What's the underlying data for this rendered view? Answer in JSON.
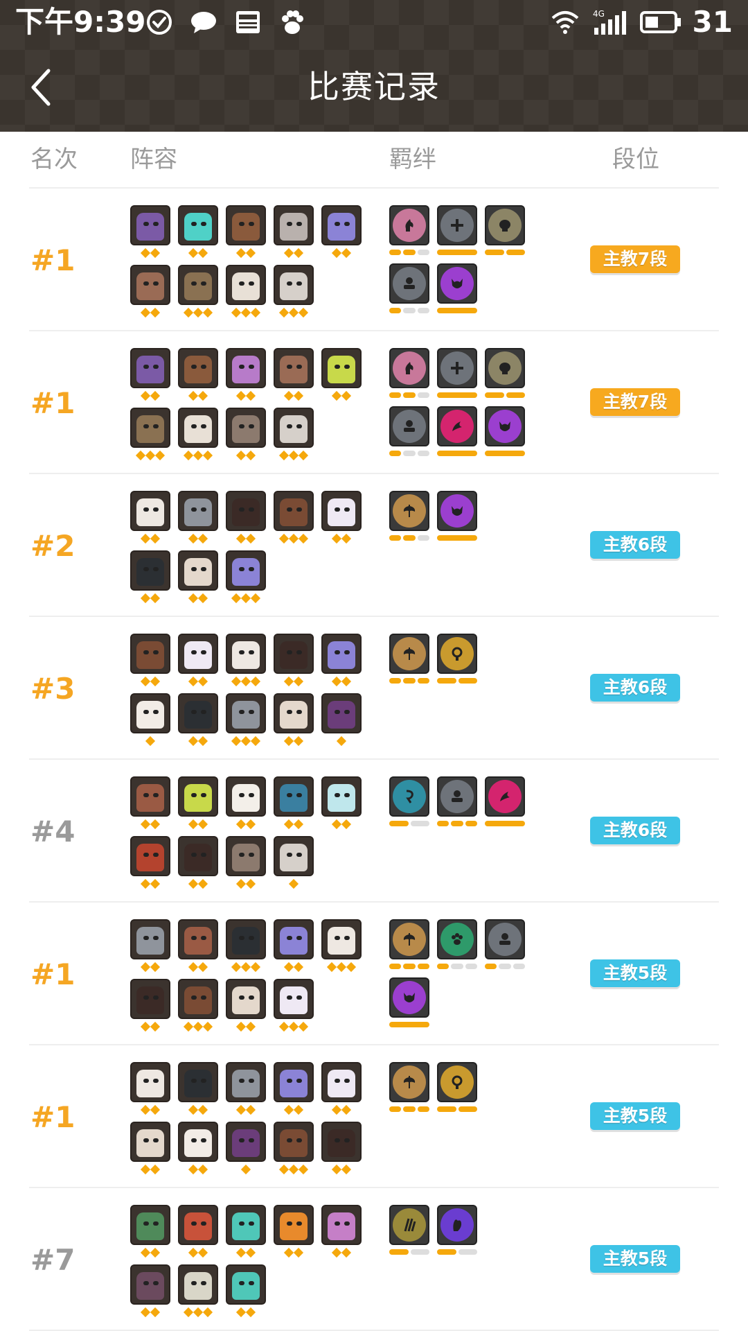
{
  "status_bar": {
    "time": "下午9:39",
    "icons": [
      "check-circle-icon",
      "chat-bubble-icon",
      "news-icon",
      "baidu-paw-icon"
    ],
    "network": "4G",
    "battery": "31"
  },
  "header": {
    "title": "比赛记录",
    "back_icon": "chevron-left-icon"
  },
  "columns": {
    "rank": "名次",
    "lineup": "阵容",
    "bonds": "羁绊",
    "tier": "段位"
  },
  "colors": {
    "rank_gold": "#f5a623",
    "rank_grey": "#9a9a9a",
    "tier_orange": "#f7a91f",
    "tier_cyan": "#3ec3e6",
    "star": "#f5a80c",
    "progress_on": "#f5a80c",
    "progress_off": "#dddddd"
  },
  "matches": [
    {
      "rank": "#1",
      "rank_color": "gold",
      "tier": "主教7段",
      "tier_color": "orange",
      "heroes": [
        {
          "face": "#7b5aa6",
          "stars": 2
        },
        {
          "face": "#4fd1c7",
          "stars": 2
        },
        {
          "face": "#8a5a3c",
          "stars": 2
        },
        {
          "face": "#b9b1ad",
          "stars": 2
        },
        {
          "face": "#8b83d6",
          "stars": 2
        },
        {
          "face": "#9a6b55",
          "stars": 2
        },
        {
          "face": "#8a7152",
          "stars": 3
        },
        {
          "face": "#e8e0d6",
          "stars": 3
        },
        {
          "face": "#d6d0ca",
          "stars": 3
        }
      ],
      "bonds": [
        {
          "color": "#c8789a",
          "glyph": "knight",
          "level": [
            2,
            3
          ]
        },
        {
          "color": "#6e737a",
          "glyph": "cross",
          "level": [
            1,
            1
          ]
        },
        {
          "color": "#8c8566",
          "glyph": "skull",
          "level": [
            2,
            2
          ]
        },
        {
          "color": "#6e737a",
          "glyph": "seat",
          "level": [
            1,
            3
          ]
        },
        {
          "color": "#9b3fcf",
          "glyph": "demon",
          "level": [
            1,
            1
          ]
        }
      ]
    },
    {
      "rank": "#1",
      "rank_color": "gold",
      "tier": "主教7段",
      "tier_color": "orange",
      "heroes": [
        {
          "face": "#7b5aa6",
          "stars": 2
        },
        {
          "face": "#8a5a3c",
          "stars": 2
        },
        {
          "face": "#b77bc9",
          "stars": 2
        },
        {
          "face": "#9a6b55",
          "stars": 2
        },
        {
          "face": "#c8d94a",
          "stars": 2
        },
        {
          "face": "#8a7152",
          "stars": 3
        },
        {
          "face": "#e8e0d6",
          "stars": 3
        },
        {
          "face": "#8c7a6e",
          "stars": 2
        },
        {
          "face": "#d6d0ca",
          "stars": 3
        }
      ],
      "bonds": [
        {
          "color": "#c8789a",
          "glyph": "knight",
          "level": [
            2,
            3
          ]
        },
        {
          "color": "#6e737a",
          "glyph": "cross",
          "level": [
            1,
            1
          ]
        },
        {
          "color": "#8c8566",
          "glyph": "skull",
          "level": [
            2,
            2
          ]
        },
        {
          "color": "#6e737a",
          "glyph": "seat",
          "level": [
            1,
            3
          ]
        },
        {
          "color": "#d4246e",
          "glyph": "dragon",
          "level": [
            1,
            1
          ]
        },
        {
          "color": "#9b3fcf",
          "glyph": "demon",
          "level": [
            1,
            1
          ]
        }
      ]
    },
    {
      "rank": "#2",
      "rank_color": "gold",
      "tier": "主教6段",
      "tier_color": "cyan",
      "heroes": [
        {
          "face": "#eee8e2",
          "stars": 2
        },
        {
          "face": "#8f949c",
          "stars": 2
        },
        {
          "face": "#3b2a26",
          "stars": 2
        },
        {
          "face": "#7a4b34",
          "stars": 3
        },
        {
          "face": "#efe9f4",
          "stars": 2
        },
        {
          "face": "#2b2f33",
          "stars": 2
        },
        {
          "face": "#e4d8cc",
          "stars": 2
        },
        {
          "face": "#8b83d6",
          "stars": 3
        }
      ],
      "bonds": [
        {
          "color": "#b88a4a",
          "glyph": "axe",
          "level": [
            2,
            3
          ]
        },
        {
          "color": "#9b3fcf",
          "glyph": "demon",
          "level": [
            1,
            1
          ]
        }
      ]
    },
    {
      "rank": "#3",
      "rank_color": "gold",
      "tier": "主教6段",
      "tier_color": "cyan",
      "heroes": [
        {
          "face": "#7a4b34",
          "stars": 2
        },
        {
          "face": "#efe9f4",
          "stars": 2
        },
        {
          "face": "#eee8e2",
          "stars": 3
        },
        {
          "face": "#3b2a26",
          "stars": 2
        },
        {
          "face": "#8b83d6",
          "stars": 2
        },
        {
          "face": "#f2ece6",
          "stars": 1
        },
        {
          "face": "#2b2f33",
          "stars": 2
        },
        {
          "face": "#8f949c",
          "stars": 3
        },
        {
          "face": "#e4d8cc",
          "stars": 2
        },
        {
          "face": "#6b3d7a",
          "stars": 1
        }
      ],
      "bonds": [
        {
          "color": "#b88a4a",
          "glyph": "axe",
          "level": [
            3,
            3
          ]
        },
        {
          "color": "#c99a2e",
          "glyph": "orb",
          "level": [
            2,
            2
          ]
        }
      ]
    },
    {
      "rank": "#4",
      "rank_color": "grey",
      "tier": "主教6段",
      "tier_color": "cyan",
      "heroes": [
        {
          "face": "#9a5a44",
          "stars": 2
        },
        {
          "face": "#c8d94a",
          "stars": 2
        },
        {
          "face": "#f3efe9",
          "stars": 2
        },
        {
          "face": "#3a7fa0",
          "stars": 2
        },
        {
          "face": "#bfe7ec",
          "stars": 2
        },
        {
          "face": "#b4432e",
          "stars": 2
        },
        {
          "face": "#3b2a26",
          "stars": 2
        },
        {
          "face": "#8c7a6e",
          "stars": 2
        },
        {
          "face": "#d6d0ca",
          "stars": 1
        }
      ],
      "bonds": [
        {
          "color": "#2f8fa3",
          "glyph": "rune",
          "level": [
            1,
            2
          ]
        },
        {
          "color": "#6e737a",
          "glyph": "seat",
          "level": [
            3,
            3
          ]
        },
        {
          "color": "#d4246e",
          "glyph": "dragon",
          "level": [
            1,
            1
          ]
        }
      ]
    },
    {
      "rank": "#1",
      "rank_color": "gold",
      "tier": "主教5段",
      "tier_color": "cyan",
      "heroes": [
        {
          "face": "#8f949c",
          "stars": 2
        },
        {
          "face": "#9a5a44",
          "stars": 2
        },
        {
          "face": "#2b2f33",
          "stars": 3
        },
        {
          "face": "#8b83d6",
          "stars": 2
        },
        {
          "face": "#eee8e2",
          "stars": 3
        },
        {
          "face": "#3b2a26",
          "stars": 2
        },
        {
          "face": "#7a4b34",
          "stars": 3
        },
        {
          "face": "#e4d8cc",
          "stars": 2
        },
        {
          "face": "#efe9f4",
          "stars": 3
        }
      ],
      "bonds": [
        {
          "color": "#b88a4a",
          "glyph": "axe",
          "level": [
            3,
            3
          ]
        },
        {
          "color": "#2e9a6a",
          "glyph": "paw",
          "level": [
            1,
            3
          ]
        },
        {
          "color": "#6e737a",
          "glyph": "seat",
          "level": [
            1,
            3
          ]
        },
        {
          "color": "#9b3fcf",
          "glyph": "demon",
          "level": [
            1,
            1
          ]
        }
      ]
    },
    {
      "rank": "#1",
      "rank_color": "gold",
      "tier": "主教5段",
      "tier_color": "cyan",
      "heroes": [
        {
          "face": "#eee8e2",
          "stars": 2
        },
        {
          "face": "#2b2f33",
          "stars": 2
        },
        {
          "face": "#8f949c",
          "stars": 2
        },
        {
          "face": "#8b83d6",
          "stars": 2
        },
        {
          "face": "#efe9f4",
          "stars": 2
        },
        {
          "face": "#e4d8cc",
          "stars": 2
        },
        {
          "face": "#f2ece6",
          "stars": 2
        },
        {
          "face": "#6b3d7a",
          "stars": 1
        },
        {
          "face": "#7a4b34",
          "stars": 3
        },
        {
          "face": "#3b2a26",
          "stars": 2
        }
      ],
      "bonds": [
        {
          "color": "#b88a4a",
          "glyph": "axe",
          "level": [
            3,
            3
          ]
        },
        {
          "color": "#c99a2e",
          "glyph": "orb",
          "level": [
            2,
            2
          ]
        }
      ]
    },
    {
      "rank": "#7",
      "rank_color": "grey",
      "tier": "主教5段",
      "tier_color": "cyan",
      "heroes": [
        {
          "face": "#4f8a5a",
          "stars": 2
        },
        {
          "face": "#c8523a",
          "stars": 2
        },
        {
          "face": "#4fc7b8",
          "stars": 2
        },
        {
          "face": "#e88a2c",
          "stars": 2
        },
        {
          "face": "#c57fc7",
          "stars": 2
        },
        {
          "face": "#6b4a5e",
          "stars": 2
        },
        {
          "face": "#d9d6c8",
          "stars": 3
        },
        {
          "face": "#4fc7b8",
          "stars": 2
        }
      ],
      "bonds": [
        {
          "color": "#9a8a3a",
          "glyph": "claw",
          "level": [
            1,
            2
          ]
        },
        {
          "color": "#6a3dd0",
          "glyph": "hand",
          "level": [
            1,
            2
          ]
        }
      ]
    }
  ]
}
